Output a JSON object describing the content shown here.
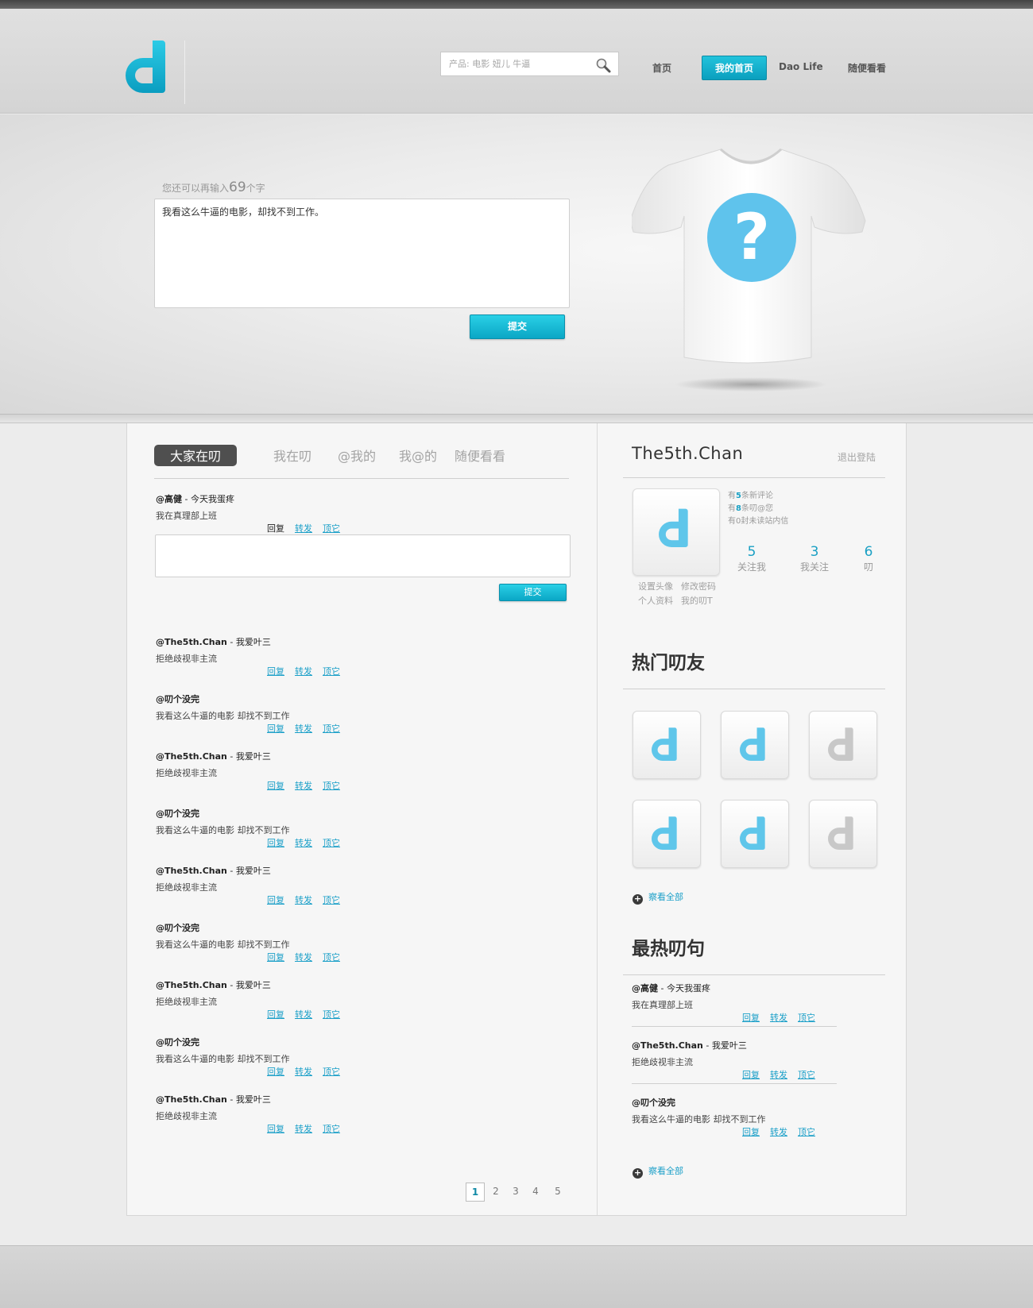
{
  "search": {
    "placeholder": "产品: 电影 妞儿 牛逼"
  },
  "nav": [
    {
      "label": "首页"
    },
    {
      "label": "我的首页"
    },
    {
      "label": "Dao Life"
    },
    {
      "label": "随便看看"
    }
  ],
  "composer": {
    "counter_prefix": "您还可以再输入",
    "counter_num": "69",
    "counter_suffix": "个字",
    "text": "我看这么牛逼的电影，却找不到工作。",
    "submit_label": "提交"
  },
  "tabs": [
    {
      "label": "大家在叨"
    },
    {
      "label": "我在叨"
    },
    {
      "label": "@我的"
    },
    {
      "label": "我@的"
    },
    {
      "label": "随便看看"
    }
  ],
  "first_post": {
    "user": "@高健",
    "sep": " - ",
    "headline": "今天我蛋疼",
    "body": "我在真理部上班",
    "actions": [
      "回复",
      "转发",
      "顶它"
    ],
    "reply_submit": "提交"
  },
  "feed": [
    {
      "user": "@The5th.Chan",
      "sep": " - ",
      "headline": "我爱叶三",
      "body": "拒绝歧视非主流"
    },
    {
      "user": "@叨个没完",
      "sep": "",
      "headline": "",
      "body": "我看这么牛逼的电影 却找不到工作"
    },
    {
      "user": "@The5th.Chan",
      "sep": " - ",
      "headline": "我爱叶三",
      "body": "拒绝歧视非主流"
    },
    {
      "user": "@叨个没完",
      "sep": "",
      "headline": "",
      "body": "我看这么牛逼的电影 却找不到工作"
    },
    {
      "user": "@The5th.Chan",
      "sep": " - ",
      "headline": "我爱叶三",
      "body": "拒绝歧视非主流"
    },
    {
      "user": "@叨个没完",
      "sep": "",
      "headline": "",
      "body": "我看这么牛逼的电影 却找不到工作"
    },
    {
      "user": "@The5th.Chan",
      "sep": " - ",
      "headline": "我爱叶三",
      "body": "拒绝歧视非主流"
    },
    {
      "user": "@叨个没完",
      "sep": "",
      "headline": "",
      "body": "我看这么牛逼的电影 却找不到工作"
    },
    {
      "user": "@The5th.Chan",
      "sep": " - ",
      "headline": "我爱叶三",
      "body": "拒绝歧视非主流"
    }
  ],
  "feed_actions": [
    "回复",
    "转发",
    "顶它"
  ],
  "pagination": {
    "pages": [
      "1",
      "2",
      "3",
      "4",
      "5"
    ],
    "current": "1"
  },
  "profile": {
    "username": "The5th.Chan",
    "logout": "退出登陆",
    "notices": [
      {
        "pre": "有",
        "num": "5",
        "post": "条新评论"
      },
      {
        "pre": "有",
        "num": "8",
        "post": "条叨@您"
      },
      {
        "pre": "有",
        "num": "0",
        "post": "封未读站内信"
      }
    ],
    "stats": [
      {
        "value": "5",
        "label": "关注我"
      },
      {
        "value": "3",
        "label": "我关注"
      },
      {
        "value": "6",
        "label": "叨"
      }
    ],
    "links_row1": [
      "设置头像",
      "修改密码"
    ],
    "links_row2": [
      "个人资料",
      "我的叨T"
    ]
  },
  "hot_friends": {
    "title": "热门叨友",
    "see_all": "察看全部",
    "avatar_colors": [
      "#5fc6ea",
      "#5fc6ea",
      "#c8c8c8",
      "#5fc6ea",
      "#5fc6ea",
      "#c8c8c8"
    ]
  },
  "hot_posts": {
    "title": "最热叨句",
    "see_all": "察看全部",
    "items": [
      {
        "user": "@高健",
        "sep": " - ",
        "headline": "今天我蛋疼",
        "body": "我在真理部上班"
      },
      {
        "user": "@The5th.Chan",
        "sep": " - ",
        "headline": "我爱叶三",
        "body": "拒绝歧视非主流"
      },
      {
        "user": "@叨个没完",
        "sep": "",
        "headline": "",
        "body": "我看这么牛逼的电影 却找不到工作"
      }
    ]
  },
  "colors": {
    "accent": "#1aa0c4",
    "brand": "#17b3d4"
  }
}
